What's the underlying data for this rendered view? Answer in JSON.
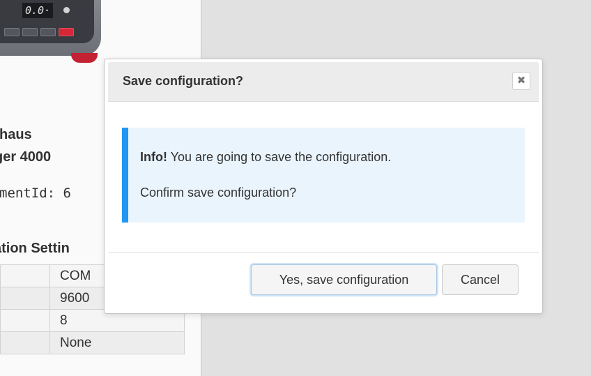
{
  "device": {
    "lcd_text": "0.0",
    "lcd_suffix": "·"
  },
  "left_panel": {
    "brand_line": "haus",
    "model_line": "ger 4000",
    "equipment_line": "mentId: 6",
    "section_heading": "ation Settin",
    "settings_rows": [
      {
        "key": "",
        "value": "COM"
      },
      {
        "key": "",
        "value": "9600"
      },
      {
        "key": "",
        "value": "8"
      },
      {
        "key": "",
        "value": "None"
      }
    ]
  },
  "modal": {
    "title": "Save configuration?",
    "close_glyph": "✖",
    "alert": {
      "label": "Info!",
      "message": " You are going to save the configuration.",
      "question": "Confirm save configuration?"
    },
    "buttons": {
      "confirm_label": "Yes, save configuration",
      "cancel_label": "Cancel"
    }
  },
  "colors": {
    "alert_accent": "#2196f3",
    "alert_background": "#e9f4fc",
    "device_foot": "#c62334"
  }
}
